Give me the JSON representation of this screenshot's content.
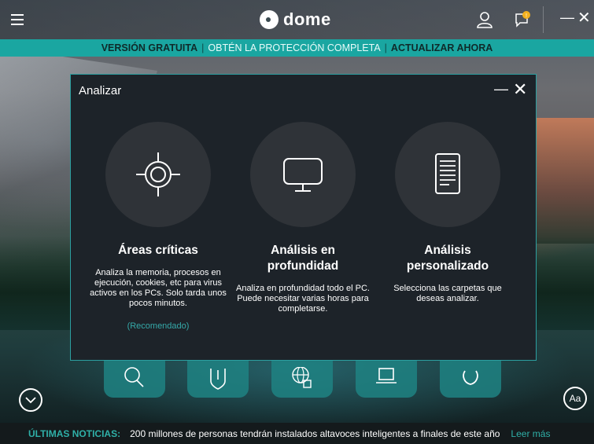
{
  "app": {
    "brand": "dome"
  },
  "promo": {
    "part1": "VERSIÓN GRATUITA",
    "separator": "|",
    "part2": "OBTÉN LA PROTECCIÓN COMPLETA",
    "part3": "ACTUALIZAR AHORA"
  },
  "dialog": {
    "title": "Analizar",
    "options": [
      {
        "icon": "crosshair-icon",
        "title": "Áreas críticas",
        "description": "Analiza la memoria, procesos en ejecución, cookies, etc para virus activos en los PCs. Solo tarda unos pocos minutos.",
        "note": "(Recomendado)"
      },
      {
        "icon": "monitor-icon",
        "title_line1": "Análisis en",
        "title_line2": "profundidad",
        "description": "Analiza en profundidad todo el PC.  Puede necesitar varias horas  para completarse."
      },
      {
        "icon": "document-icon",
        "title_line1": "Análisis",
        "title_line2": "personalizado",
        "description": "Selecciona las carpetas que deseas analizar."
      }
    ]
  },
  "font_button": {
    "label": "Aa"
  },
  "news": {
    "label": "ÚLTIMAS NOTICIAS:",
    "text": "200 millones de personas tendrán instalados altavoces inteligentes a finales de este año",
    "link": "Leer más"
  },
  "colors": {
    "accent": "#1aa6a1",
    "dialog_bg": "#1d2329",
    "link": "#35a9a9"
  }
}
